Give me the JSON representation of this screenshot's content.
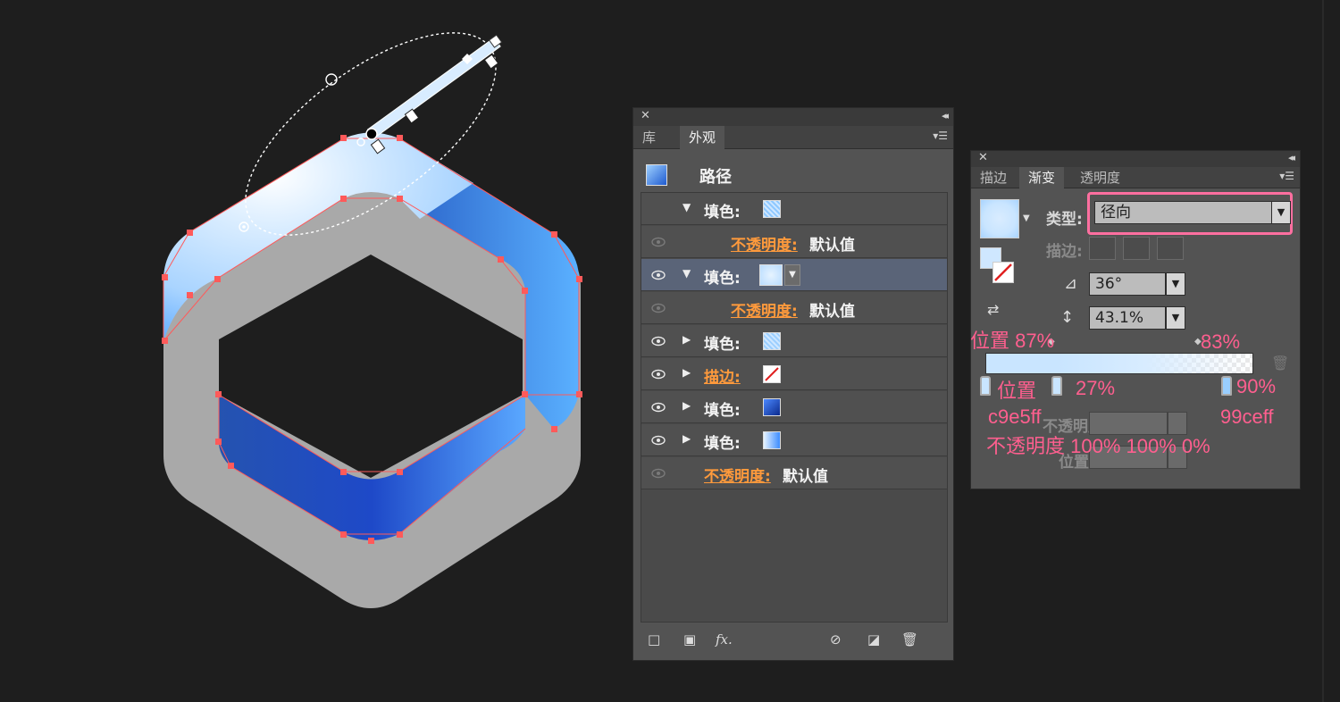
{
  "appearance_panel": {
    "tabs": [
      "库",
      "外观"
    ],
    "active_tab": "外观",
    "path_title": "路径",
    "rows": [
      {
        "kind": "fill",
        "label": "填色:",
        "expanded": true
      },
      {
        "kind": "opacity",
        "label": "不透明度:",
        "value": "默认值"
      },
      {
        "kind": "fill",
        "label": "填色:",
        "expanded": true,
        "selected": true
      },
      {
        "kind": "opacity",
        "label": "不透明度:",
        "value": "默认值"
      },
      {
        "kind": "fill",
        "label": "填色:"
      },
      {
        "kind": "stroke",
        "label": "描边:"
      },
      {
        "kind": "fill",
        "label": "填色:"
      },
      {
        "kind": "fill",
        "label": "填色:"
      },
      {
        "kind": "opacity",
        "label": "不透明度:",
        "value": "默认值"
      }
    ],
    "bottom_icons": [
      "add-stroke-icon",
      "add-fill-icon",
      "fx-icon",
      "clear-icon",
      "duplicate-icon",
      "trash-icon"
    ],
    "fx_label": "fx."
  },
  "gradient_panel": {
    "tabs": [
      "描边",
      "渐变",
      "透明度"
    ],
    "active_tab": "渐变",
    "type_label": "类型:",
    "type_value": "径向",
    "stroke_label": "描边:",
    "angle_value": "36°",
    "aspect_value": "43.1%",
    "opacity_label": "不透明度:",
    "location_label": "位置:"
  },
  "annotations": {
    "pos_87": "位置  87%",
    "pct_83": "83%",
    "pos_27_label": "位置",
    "pct_27": "27%",
    "pct_90": "90%",
    "color_1": "c9e5ff",
    "color_2": "99ceff",
    "opacity_line": "不透明度      100% 100% 0%"
  },
  "colors": {
    "annotation": "#ff5f8f",
    "highlight_box": "#ff6fa0",
    "grad_light": "#c9e5ff",
    "grad_mid": "#99ceff",
    "blue_dark": "#1f4fb0",
    "blue_bright": "#55aaff",
    "gray_shape": "#a8a8a8"
  }
}
